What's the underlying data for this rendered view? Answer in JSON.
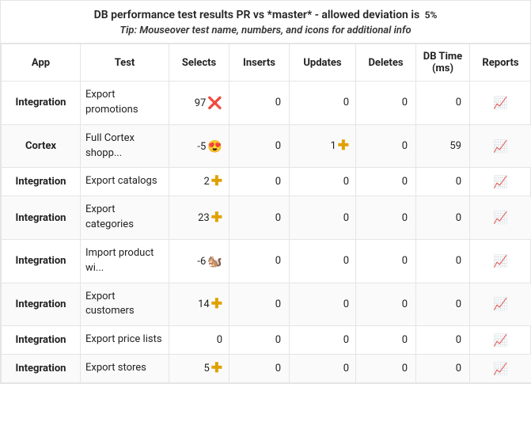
{
  "header": {
    "title_pre": "DB performance test results PR vs *master* - allowed deviation is",
    "deviation": "5%",
    "tip": "Tip: Mouseover test name, numbers, and icons for additional info"
  },
  "columns": {
    "app": "App",
    "test": "Test",
    "selects": "Selects",
    "inserts": "Inserts",
    "updates": "Updates",
    "deletes": "Deletes",
    "db_time": "DB Time (ms)",
    "reports": "Reports"
  },
  "rows": [
    {
      "app": "Integration",
      "test": "Export promotions",
      "selects_val": "97",
      "selects_icon": "cross",
      "inserts": "0",
      "updates": "0",
      "updates_icon": "",
      "deletes": "0",
      "db_time": "0",
      "report_icon": "chart"
    },
    {
      "app": "Cortex",
      "test": "Full Cortex shopp...",
      "selects_val": "-5",
      "selects_icon": "heart",
      "inserts": "0",
      "updates": "1",
      "updates_icon": "plus",
      "deletes": "0",
      "db_time": "59",
      "report_icon": "chart"
    },
    {
      "app": "Integration",
      "test": "Export catalogs",
      "selects_val": "2",
      "selects_icon": "plus",
      "inserts": "0",
      "updates": "0",
      "updates_icon": "",
      "deletes": "0",
      "db_time": "0",
      "report_icon": "chart"
    },
    {
      "app": "Integration",
      "test": "Export categories",
      "selects_val": "23",
      "selects_icon": "plus",
      "inserts": "0",
      "updates": "0",
      "updates_icon": "",
      "deletes": "0",
      "db_time": "0",
      "report_icon": "chart"
    },
    {
      "app": "Integration",
      "test": "Import product wi...",
      "selects_val": "-6",
      "selects_icon": "squirrel",
      "inserts": "0",
      "updates": "0",
      "updates_icon": "",
      "deletes": "0",
      "db_time": "0",
      "report_icon": "chart"
    },
    {
      "app": "Integration",
      "test": "Export customers",
      "selects_val": "14",
      "selects_icon": "plus",
      "inserts": "0",
      "updates": "0",
      "updates_icon": "",
      "deletes": "0",
      "db_time": "0",
      "report_icon": "chart"
    },
    {
      "app": "Integration",
      "test": "Export price lists",
      "selects_val": "0",
      "selects_icon": "",
      "inserts": "0",
      "updates": "0",
      "updates_icon": "",
      "deletes": "0",
      "db_time": "0",
      "report_icon": "chart"
    },
    {
      "app": "Integration",
      "test": "Export stores",
      "selects_val": "5",
      "selects_icon": "plus",
      "inserts": "0",
      "updates": "0",
      "updates_icon": "",
      "deletes": "0",
      "db_time": "0",
      "report_icon": "chart"
    }
  ],
  "icons": {
    "cross": "❌",
    "heart": "😍",
    "plus": "✚",
    "squirrel": "🐿️",
    "chart": "📈"
  }
}
